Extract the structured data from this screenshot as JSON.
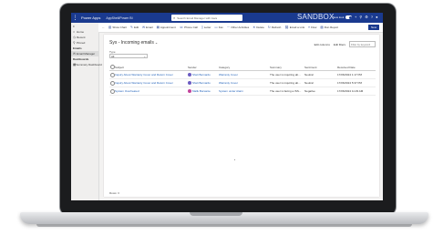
{
  "topbar": {
    "brand": "Power Apps",
    "app_name": "AppShell/Power BI",
    "search_placeholder": "Search Email Manager with Java",
    "environment_label": "SANDBOX",
    "new_look_label": "New look",
    "colors": {
      "bar": "#1a3a8f"
    }
  },
  "left_nav": {
    "items": [
      {
        "label": "Home",
        "icon": "home-icon"
      },
      {
        "label": "Recent",
        "icon": "clock-icon"
      },
      {
        "label": "Pinned",
        "icon": "pin-icon"
      }
    ],
    "group_emails": "Emails",
    "email_manager": "Email Manager",
    "group_dashboards": "Dashboards",
    "summary_dashboard": "Summary Dashboard"
  },
  "command_bar": {
    "items": [
      "Show Chart",
      "Edit",
      "Email",
      "Appointment",
      "Phone Call",
      "Letter",
      "Fax",
      "Other Activities",
      "Delete",
      "Refresh",
      "Email a Link",
      "Flow",
      "Run Report"
    ],
    "new_label": "New"
  },
  "view": {
    "title": "Sys - Incoming emails",
    "edit_columns": "Edit columns",
    "edit_filters": "Edit filters",
    "filter_placeholder": "Filter by keyword",
    "type_label": "Type",
    "type_value": "All"
  },
  "grid": {
    "columns": [
      "Subject",
      "Sender",
      "Category",
      "Summary",
      "Sentiment",
      "Received Date"
    ],
    "rows": [
      {
        "subject": "Inquiry About Warranty Cover and Return Cover",
        "sender": "Sheli Bernardo",
        "category": "Warranty Cover",
        "summary": "The user is inquiring ab...",
        "sentiment": "Neutral",
        "received": "17/06/2024 1:17 PM",
        "avatar_color": "#6b5cc2"
      },
      {
        "subject": "Inquiry About Warranty Cover and Return Cover",
        "sender": "Sheli Bernardo",
        "category": "Warranty Cover",
        "summary": "The user is inquiring ab...",
        "sentiment": "Neutral",
        "received": "17/06/2024 5:37 PM",
        "avatar_color": "#6b5cc2"
      },
      {
        "subject": "System Overheated",
        "sender": "Malik Borsante",
        "category": "System under Alarm",
        "summary": "The user is facing a ISS...",
        "sentiment": "Negative",
        "received": "17/06/2024 11:29 AM",
        "avatar_color": "#c2439b"
      }
    ]
  },
  "footer": {
    "rows_label": "Rows: 3"
  }
}
